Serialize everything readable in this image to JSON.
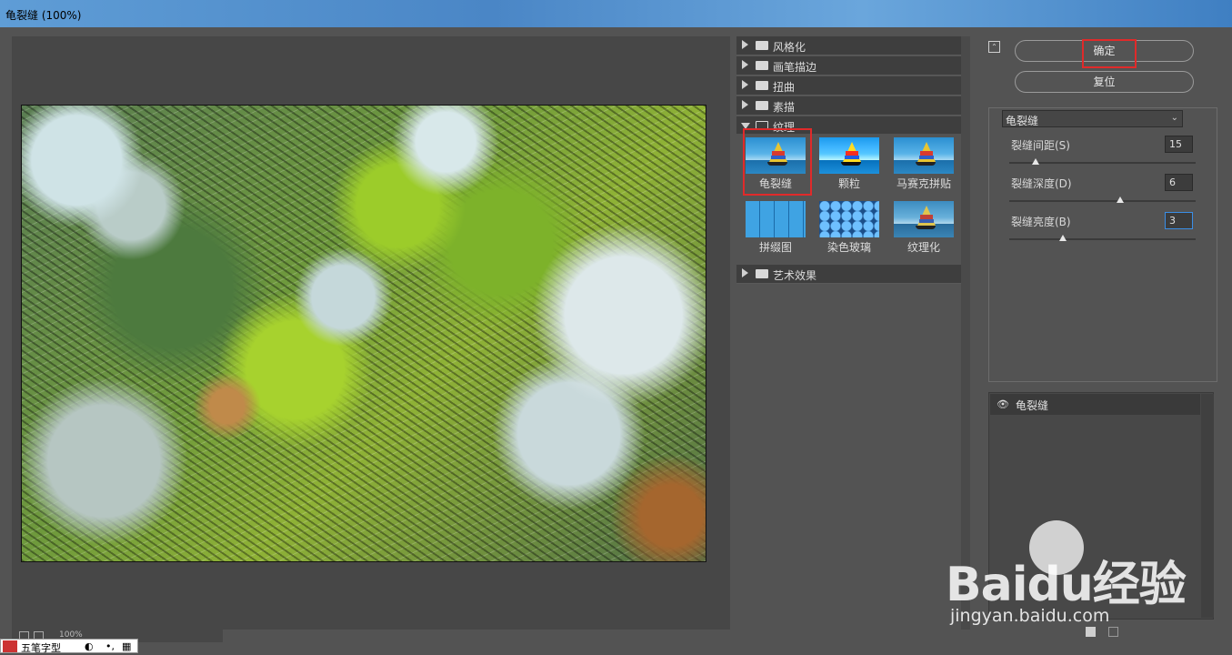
{
  "window": {
    "title": "龟裂缝 (100%)"
  },
  "preview": {
    "zoom": "100%"
  },
  "ime": {
    "label": "五笔字型"
  },
  "gallery": {
    "categories": [
      "风格化",
      "画笔描边",
      "扭曲",
      "素描",
      "纹理",
      "艺术效果"
    ],
    "open_category": "纹理",
    "filters": [
      "龟裂缝",
      "颗粒",
      "马赛克拼贴",
      "拼缀图",
      "染色玻璃",
      "纹理化"
    ],
    "selected_filter": "龟裂缝"
  },
  "actions": {
    "ok_label": "确定",
    "reset_label": "复位"
  },
  "params": {
    "filter_select": "龟裂缝",
    "spacing_label": "裂缝间距(S)",
    "spacing_value": "15",
    "depth_label": "裂缝深度(D)",
    "depth_value": "6",
    "brightness_label": "裂缝亮度(B)",
    "brightness_value": "3"
  },
  "layers": {
    "items": [
      "龟裂缝"
    ]
  },
  "watermark": {
    "brand": "Baidu经验",
    "url": "jingyan.baidu.com"
  }
}
